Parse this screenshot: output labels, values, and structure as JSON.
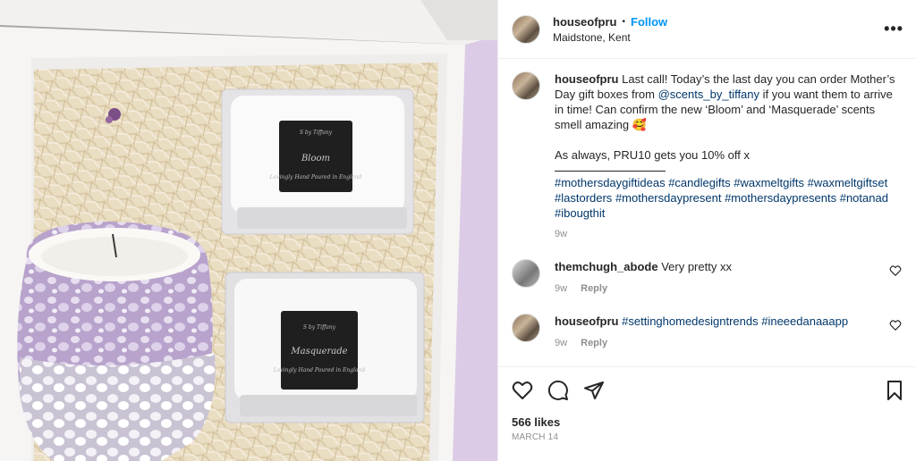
{
  "post": {
    "username": "houseofpru",
    "follow_label": "Follow",
    "location": "Maidstone, Kent",
    "more_label": "•••"
  },
  "photo": {
    "candle1_title": "Bloom",
    "candle2_title": "Masquerade",
    "brand_script": "Lovingly Hand Poured in England",
    "logo_text": "S by Tiffany"
  },
  "caption": {
    "username": "houseofpru",
    "text_a": " Last call! Today’s the last day you can order Mother’s Day gift boxes from ",
    "mention": "@scents_by_tiffany",
    "text_b": " if you want them to arrive in time! Can confirm the new ‘Bloom’ and ‘Masquerade’ scents smell amazing ",
    "emoji": "🥰",
    "text_c": "As always, PRU10 gets you 10% off x",
    "tags": [
      "#mothersdaygiftideas",
      "#candlegifts",
      "#waxmeltgifts",
      "#waxmeltgiftset",
      "#lastorders",
      "#mothersdaypresent",
      "#mothersdaypresents",
      "#notanad",
      "#ibougthit"
    ],
    "time": "9w"
  },
  "comments": [
    {
      "username": "themchugh_abode",
      "text": "Very pretty xx",
      "time": "9w",
      "reply": "Reply"
    },
    {
      "username": "houseofpru",
      "text": "#settinghomedesigntrends #ineeedanaaapp",
      "time": "9w",
      "reply": "Reply"
    }
  ],
  "footer": {
    "likes": "566 likes",
    "date": "MARCH 14"
  },
  "colors": {
    "link": "#0095f6",
    "hashtag": "#00376b",
    "muted": "#8e8e8e"
  },
  "icons": [
    "more-icon",
    "heart-icon",
    "comment-icon",
    "share-icon",
    "bookmark-icon"
  ]
}
